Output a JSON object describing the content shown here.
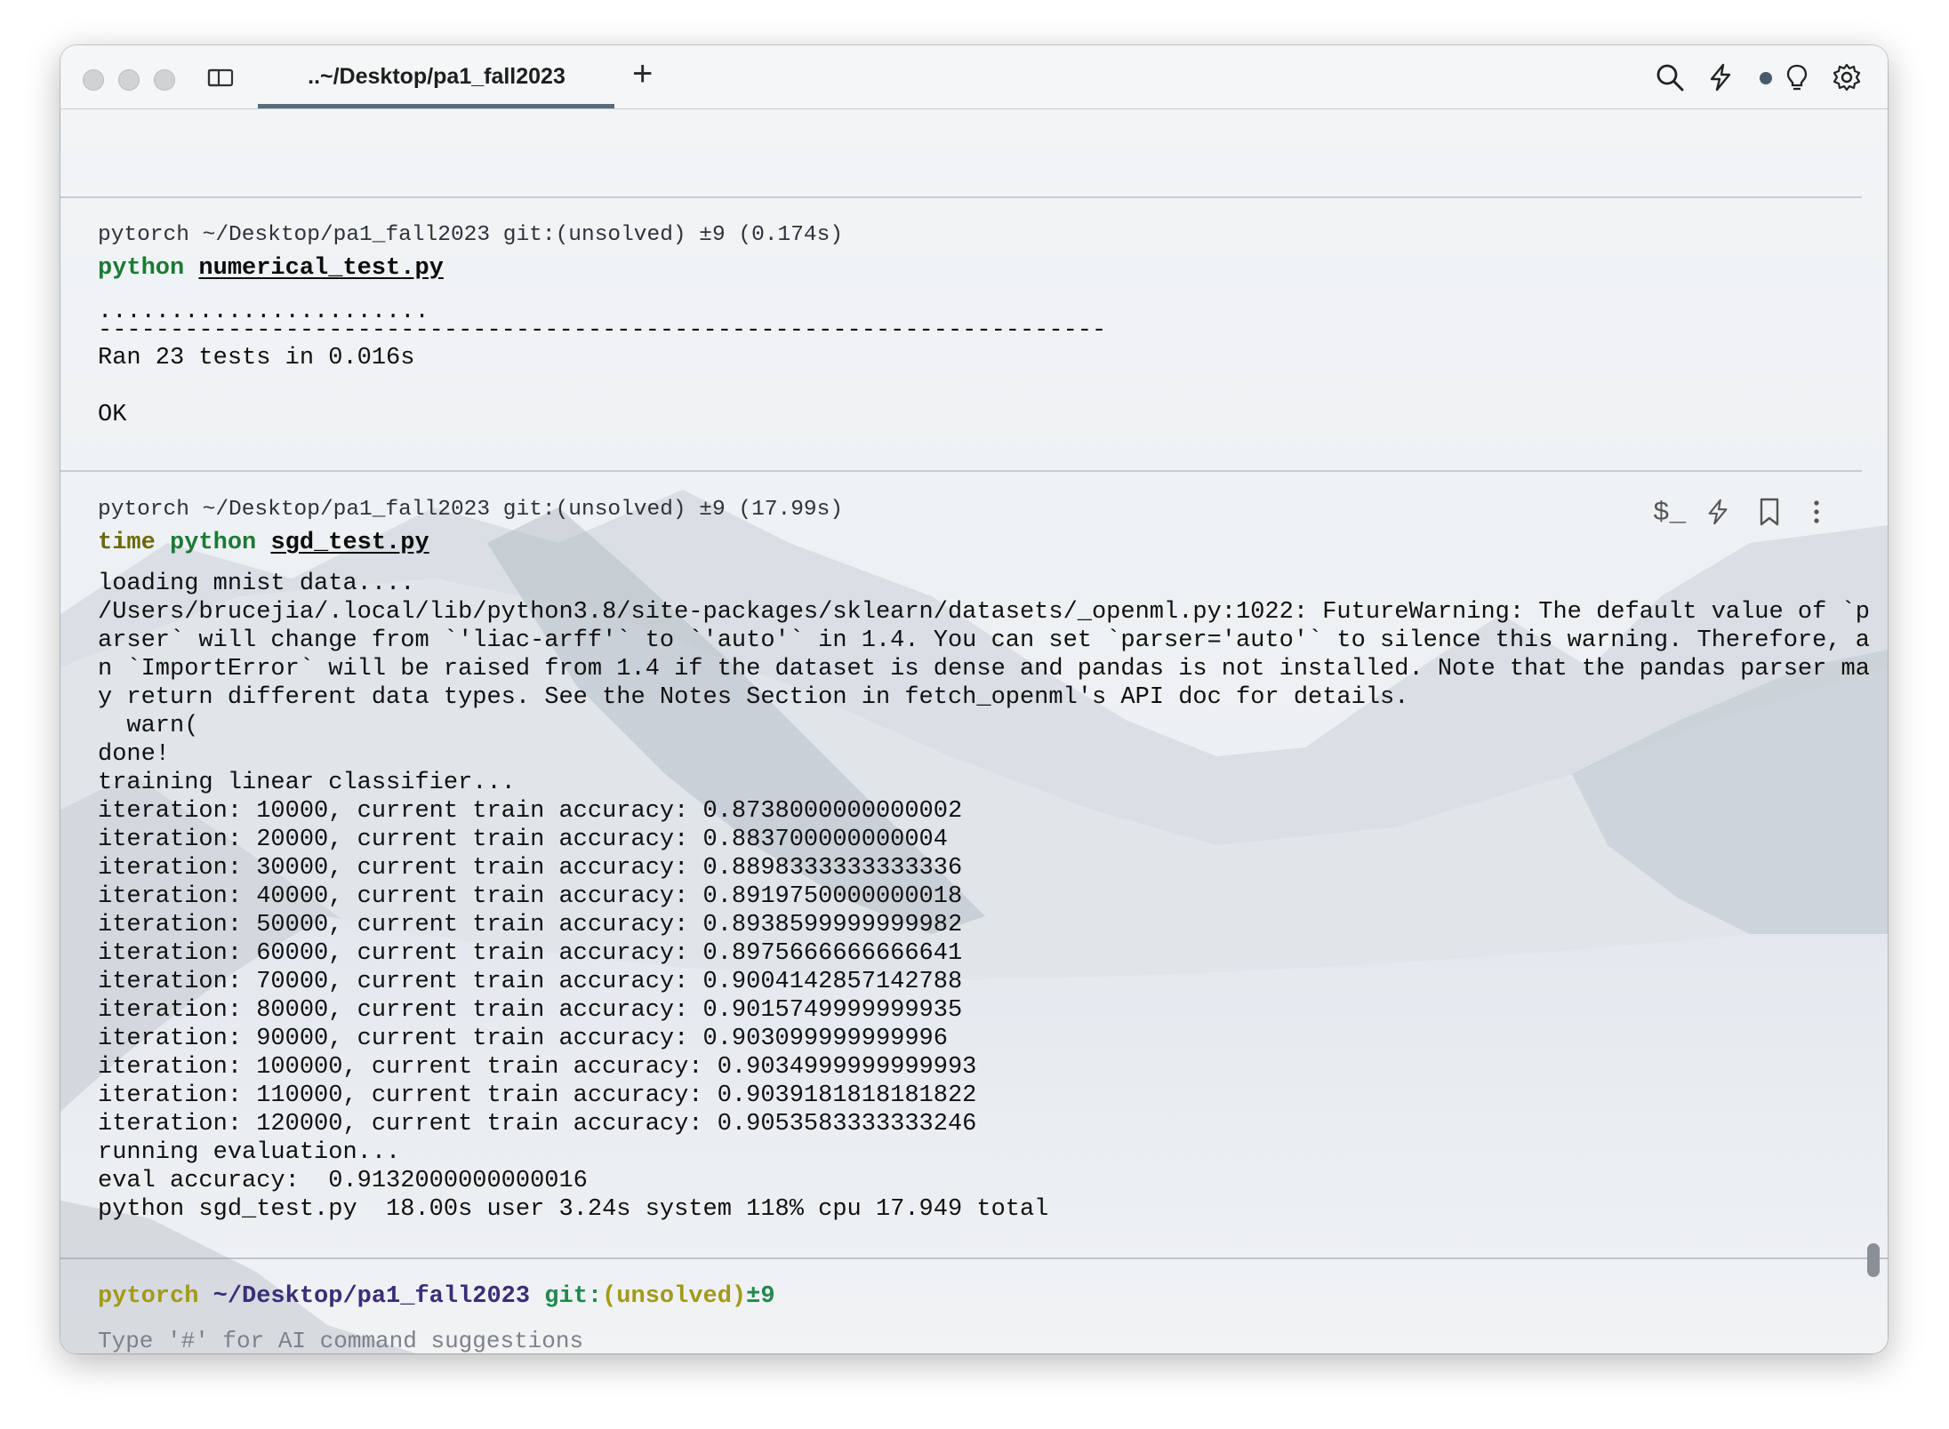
{
  "window": {
    "tab_title": "..~/Desktop/pa1_fall2023",
    "new_tab_label": "+"
  },
  "block1": {
    "header": "pytorch ~/Desktop/pa1_fall2023 git:(unsolved) ±9 (0.174s)",
    "cmd_keyword": "python",
    "cmd_arg": "numerical_test.py",
    "output": [
      ".......................",
      "----------------------------------------------------------------------",
      "Ran 23 tests in 0.016s",
      "",
      "OK"
    ]
  },
  "block2": {
    "header": "pytorch ~/Desktop/pa1_fall2023 git:(unsolved) ±9 (17.99s)",
    "cmd_time": "time",
    "cmd_keyword": "python",
    "cmd_arg": "sgd_test.py",
    "output": [
      "loading mnist data....",
      "/Users/brucejia/.local/lib/python3.8/site-packages/sklearn/datasets/_openml.py:1022: FutureWarning: The default value of `p",
      "arser` will change from `'liac-arff'` to `'auto'` in 1.4. You can set `parser='auto'` to silence this warning. Therefore, a",
      "n `ImportError` will be raised from 1.4 if the dataset is dense and pandas is not installed. Note that the pandas parser ma",
      "y return different data types. See the Notes Section in fetch_openml's API doc for details.",
      "  warn(",
      "done!",
      "training linear classifier...",
      "iteration: 10000, current train accuracy: 0.8738000000000002",
      "iteration: 20000, current train accuracy: 0.883700000000004",
      "iteration: 30000, current train accuracy: 0.8898333333333336",
      "iteration: 40000, current train accuracy: 0.8919750000000018",
      "iteration: 50000, current train accuracy: 0.8938599999999982",
      "iteration: 60000, current train accuracy: 0.8975666666666641",
      "iteration: 70000, current train accuracy: 0.9004142857142788",
      "iteration: 80000, current train accuracy: 0.9015749999999935",
      "iteration: 90000, current train accuracy: 0.903099999999996",
      "iteration: 100000, current train accuracy: 0.9034999999999993",
      "iteration: 110000, current train accuracy: 0.9039181818181822",
      "iteration: 120000, current train accuracy: 0.9053583333333246",
      "running evaluation...",
      "eval accuracy:  0.9132000000000016",
      "python sgd_test.py  18.00s user 3.24s system 118% cpu 17.949 total"
    ]
  },
  "prompt": {
    "env": "pytorch",
    "path": "~/Desktop/pa1_fall2023",
    "git": "git:",
    "branch": "(unsolved)",
    "status": "±9",
    "input_placeholder": "Type '#' for AI command suggestions"
  },
  "block_actions": {
    "shell_label": "$_"
  },
  "colors": {
    "command_green": "#1d7a36",
    "time_olive": "#6b6a10",
    "prompt_path_purple": "#3b2d78",
    "prompt_env_yellow": "#a29a1a"
  },
  "icons": [
    "window-split-icon",
    "search-icon",
    "lightning-icon",
    "status-dot-icon",
    "lightbulb-icon",
    "gear-icon",
    "lightning-icon",
    "bookmark-icon",
    "more-vertical-icon"
  ]
}
